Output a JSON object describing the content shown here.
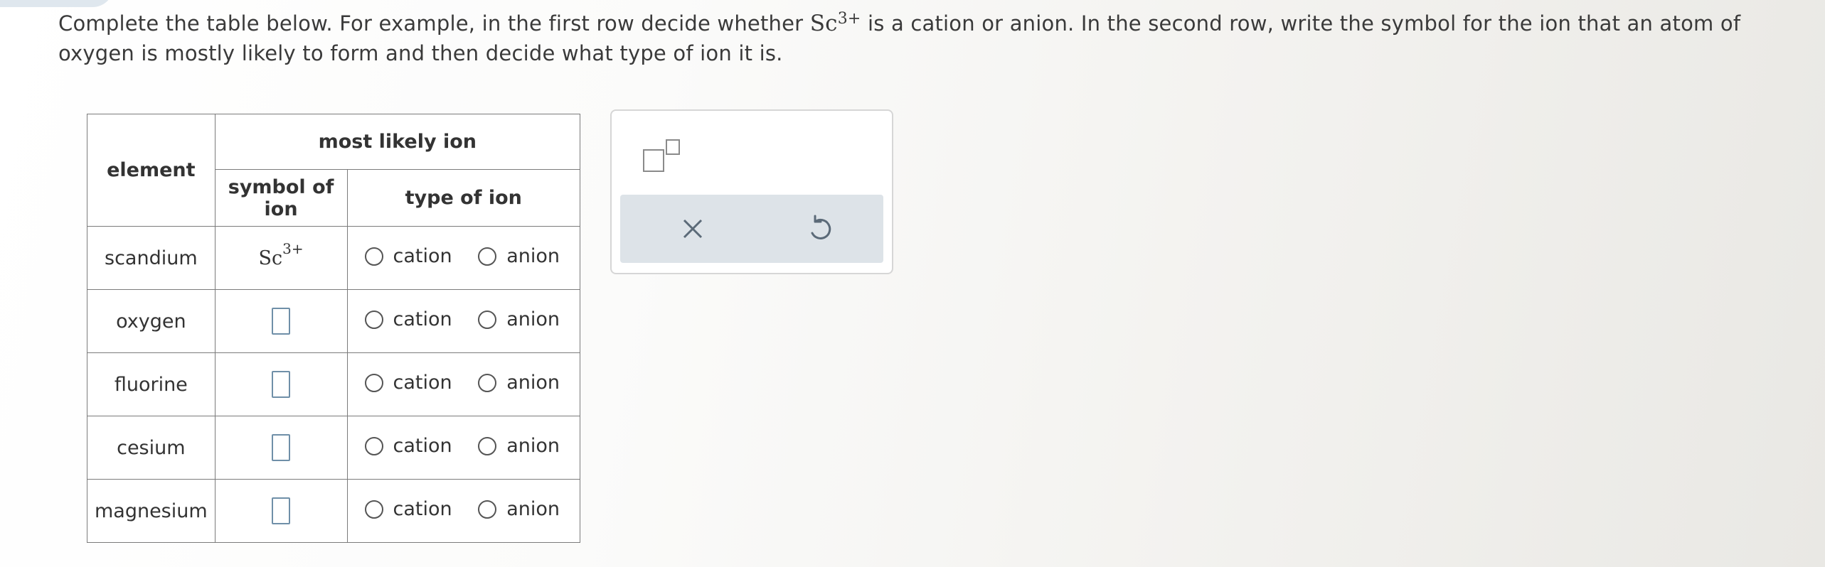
{
  "question": {
    "part1": "Complete the table below. For example, in the first row decide whether ",
    "sc_symbol": "Sc",
    "sc_charge": "3+",
    "part2": " is a cation or anion. In the second row, write the symbol for the ion that an atom of oxygen is mostly likely to form and then decide what type of ion it is."
  },
  "table": {
    "header_element": "element",
    "header_most_likely": "most likely ion",
    "header_symbol": "symbol of ion",
    "header_type": "type of ion",
    "option_cation": "cation",
    "option_anion": "anion",
    "rows": [
      {
        "element": "scandium",
        "symbol": "Sc",
        "charge": "3+"
      },
      {
        "element": "oxygen"
      },
      {
        "element": "fluorine"
      },
      {
        "element": "cesium"
      },
      {
        "element": "magnesium"
      }
    ]
  },
  "tools": {
    "superscript_icon": "superscript-box-icon",
    "clear_icon": "close-x-icon",
    "undo_icon": "undo-icon"
  },
  "colors": {
    "input_box_border": "#6f8fa8",
    "action_bar_bg": "#dde3e8"
  }
}
